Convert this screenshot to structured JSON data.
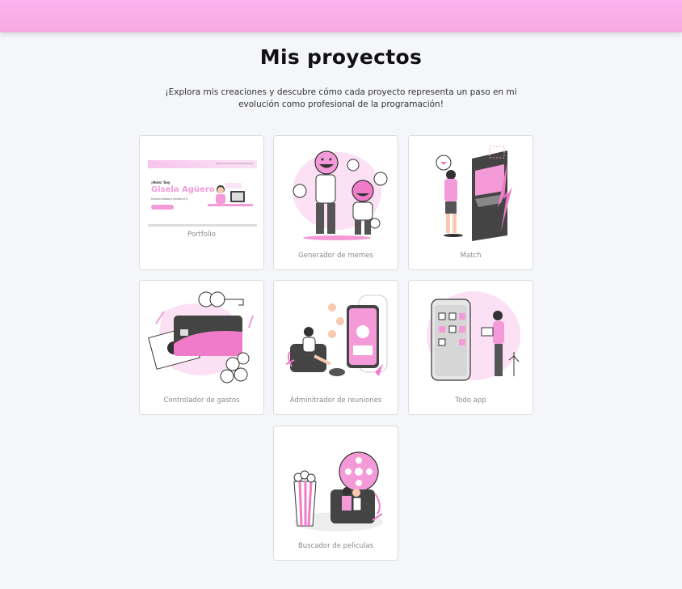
{
  "header": {
    "title": "Mis proyectos",
    "subtitle": "¡Explora mis creaciones y descubre cómo cada proyecto representa un paso en mi evolución como profesional de la programación!"
  },
  "colors": {
    "accent": "#f49ad9",
    "topbar": "#f9b4f0",
    "background": "#f5f6fa"
  },
  "projects": [
    {
      "label": "Portfolio",
      "icon": "portfolio-screenshot",
      "preview": {
        "greeting": "¡Hola! Soy",
        "name": "Gisela Agüero",
        "role": "Desarrolladora frontend Jr.",
        "nav": "Inicio   Conocimientos   Proyectos"
      }
    },
    {
      "label": "Generador de memes",
      "icon": "emoji-people-illustration"
    },
    {
      "label": "Match",
      "icon": "arcade-illustration"
    },
    {
      "label": "Controlador de gastos",
      "icon": "credit-card-illustration"
    },
    {
      "label": "Adminitrador de reuniones",
      "icon": "meeting-phone-illustration"
    },
    {
      "label": "Todo app",
      "icon": "todo-phone-illustration"
    },
    {
      "label": "Buscador de peliculas",
      "icon": "cinema-illustration"
    }
  ]
}
